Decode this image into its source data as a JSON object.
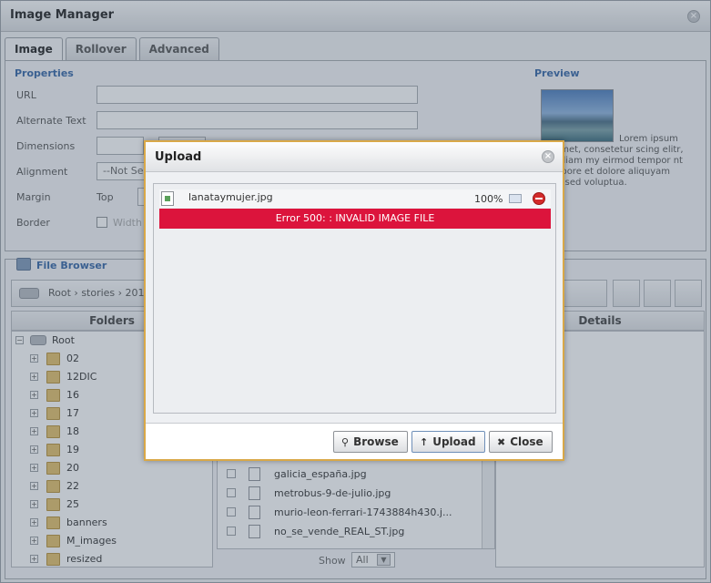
{
  "window": {
    "title": "Image Manager"
  },
  "tabs": [
    {
      "label": "Image",
      "active": true
    },
    {
      "label": "Rollover",
      "active": false
    },
    {
      "label": "Advanced",
      "active": false
    }
  ],
  "properties": {
    "heading": "Properties",
    "url_label": "URL",
    "alt_label": "Alternate Text",
    "dimensions_label": "Dimensions",
    "alignment_label": "Alignment",
    "alignment_value": "--Not Se",
    "margin_label": "Margin",
    "margin_top_label": "Top",
    "border_label": "Border",
    "border_width_label": "Width"
  },
  "preview": {
    "heading": "Preview",
    "text": "Lorem ipsum sit amet, consetetur scing elitr, sed diam my eirmod tempor nt ut labore et dolore aliquyam erat, sed voluptua."
  },
  "file_browser": {
    "heading": "File Browser",
    "breadcrumb": "Root › stories › 201",
    "folders_header": "Folders",
    "details_header": "Details",
    "folders": [
      {
        "name": "Root",
        "root": true
      },
      {
        "name": "02"
      },
      {
        "name": "12DIC"
      },
      {
        "name": "16"
      },
      {
        "name": "17"
      },
      {
        "name": "18"
      },
      {
        "name": "19"
      },
      {
        "name": "20"
      },
      {
        "name": "22"
      },
      {
        "name": "25"
      },
      {
        "name": "banners"
      },
      {
        "name": "M_images"
      },
      {
        "name": "resized"
      }
    ],
    "files": [
      "galicia_españa.jpg",
      "metrobus-9-de-julio.jpg",
      "murio-leon-ferrari-1743884h430.j...",
      "no_se_vende_REAL_ST.jpg"
    ],
    "show_label": "Show",
    "show_value": "All"
  },
  "upload": {
    "title": "Upload",
    "file_name": "lanataymujer.jpg",
    "progress": "100%",
    "error": "Error 500: : INVALID IMAGE FILE",
    "browse_label": "Browse",
    "upload_label": "Upload",
    "close_label": "Close"
  }
}
